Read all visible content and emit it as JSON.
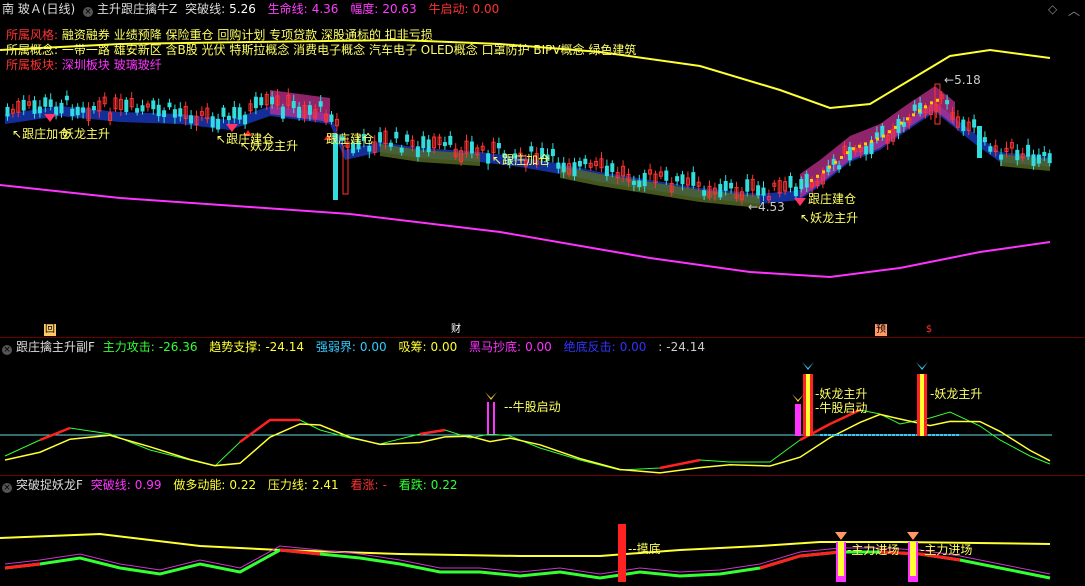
{
  "main": {
    "name": "南 玻Ａ(日线)",
    "indicator": "主升跟庄擒牛Z",
    "vals": [
      {
        "label": "突破线:",
        "value": "5.26",
        "color": "#ffffff"
      },
      {
        "label": "生命线:",
        "value": "4.36",
        "color": "#ff3cff"
      },
      {
        "label": "幅度:",
        "value": "20.63",
        "color": "#ff3cff"
      },
      {
        "label": "牛启动:",
        "value": "0.00",
        "color": "#ff3333"
      }
    ],
    "info1_label": "所属风格:",
    "info1": "融资融券 业绩预降 保险重仓 回购计划 专项贷款 深股通标的 扣非亏损",
    "info2_label": "所属概念:",
    "info2": "一带一路 雄安新区 含B股 光伏 特斯拉概念 消费电子概念 汽车电子 OLED概念 口罩防护 BIPV概念 绿色建筑",
    "info3_label": "所属板块:",
    "info3": "深圳板块 玻璃玻纤",
    "high": "5.18",
    "low": "4.53",
    "annotations": [
      "跟庄加仓",
      "妖龙主升",
      "跟庄建仓",
      "妖龙主升",
      "跟庄建仓",
      "跟庄加仓",
      "跟庄建仓",
      "妖龙主升"
    ],
    "badges": [
      "回",
      "财",
      "预",
      "$"
    ]
  },
  "sub1": {
    "title": "跟庄擒主升副F",
    "vals": [
      {
        "label": "主力攻击:",
        "value": "-26.36",
        "color": "#33ff33"
      },
      {
        "label": "趋势支撑:",
        "value": "-24.14",
        "color": "#ffff33"
      },
      {
        "label": "强弱界:",
        "value": "0.00",
        "color": "#33ccff"
      },
      {
        "label": "吸筹:",
        "value": "0.00",
        "color": "#ffff33"
      },
      {
        "label": "黑马抄底:",
        "value": "0.00",
        "color": "#ff33ff"
      },
      {
        "label": "绝底反击:",
        "value": "0.00",
        "color": "#3333ff"
      },
      {
        "label": ":",
        "value": "-24.14",
        "color": "#cccccc"
      }
    ],
    "annotations": [
      "牛股启动",
      "妖龙主升",
      "牛股启动",
      "妖龙主升"
    ]
  },
  "sub2": {
    "title": "突破捉妖龙F",
    "vals": [
      {
        "label": "突破线:",
        "value": "0.99",
        "color": "#ff33ff"
      },
      {
        "label": "做多动能:",
        "value": "0.22",
        "color": "#ffff33"
      },
      {
        "label": "压力线:",
        "value": "2.41",
        "color": "#ffff33"
      },
      {
        "label": "看涨:",
        "value": "-",
        "color": "#ff3333"
      },
      {
        "label": "看跌:",
        "value": "0.22",
        "color": "#33ff33"
      }
    ],
    "annotations": [
      "摸底",
      "主力进场",
      "主力进场"
    ]
  },
  "chart_data": {
    "type": "line",
    "title": "南 玻Ａ(日线)",
    "price_high": 5.18,
    "price_low": 4.53,
    "close_trend": [
      5.02,
      5.03,
      5.0,
      4.98,
      4.96,
      5.0,
      4.98,
      4.95,
      4.9,
      4.88,
      4.85,
      4.8,
      4.75,
      4.72,
      4.68,
      4.62,
      4.55,
      4.6,
      4.7,
      4.85,
      5.0,
      5.18,
      5.05,
      4.95,
      4.93
    ]
  }
}
